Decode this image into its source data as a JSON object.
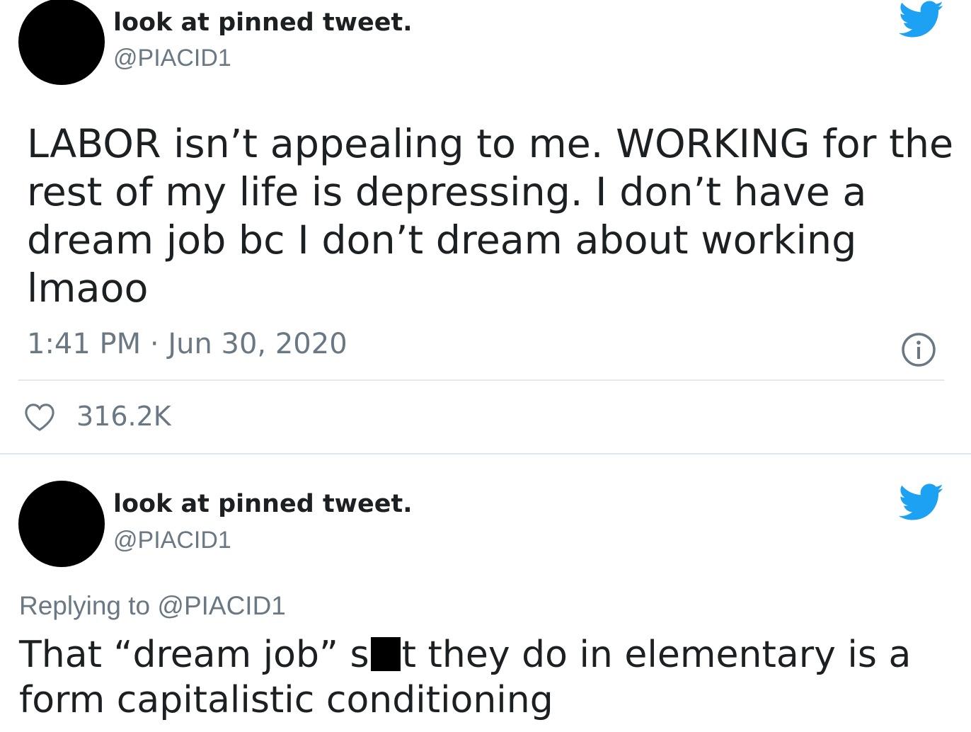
{
  "tweets": [
    {
      "display_name": "look at pinned tweet.",
      "handle": "@PIACID1",
      "text": "LABOR isn’t appealing to me. WORKING for the rest of my life is depressing. I don’t have a dream job bc I don’t dream about working lmaoo",
      "timestamp": "1:41 PM · Jun 30, 2020",
      "likes": "316.2K"
    },
    {
      "display_name": "look at pinned tweet.",
      "handle": "@PIACID1",
      "replying_to": "Replying to @PIACID1",
      "text_before_redaction": "That “dream job” s",
      "text_after_redaction": "t they do in elementary is a form capitalistic conditioning"
    }
  ],
  "colors": {
    "twitter_blue": "#1da1f2",
    "text_primary": "#1c2022",
    "text_secondary": "#697882",
    "divider": "#e1e8ed"
  },
  "icons": [
    "twitter-bird-icon",
    "info-icon",
    "heart-icon"
  ]
}
